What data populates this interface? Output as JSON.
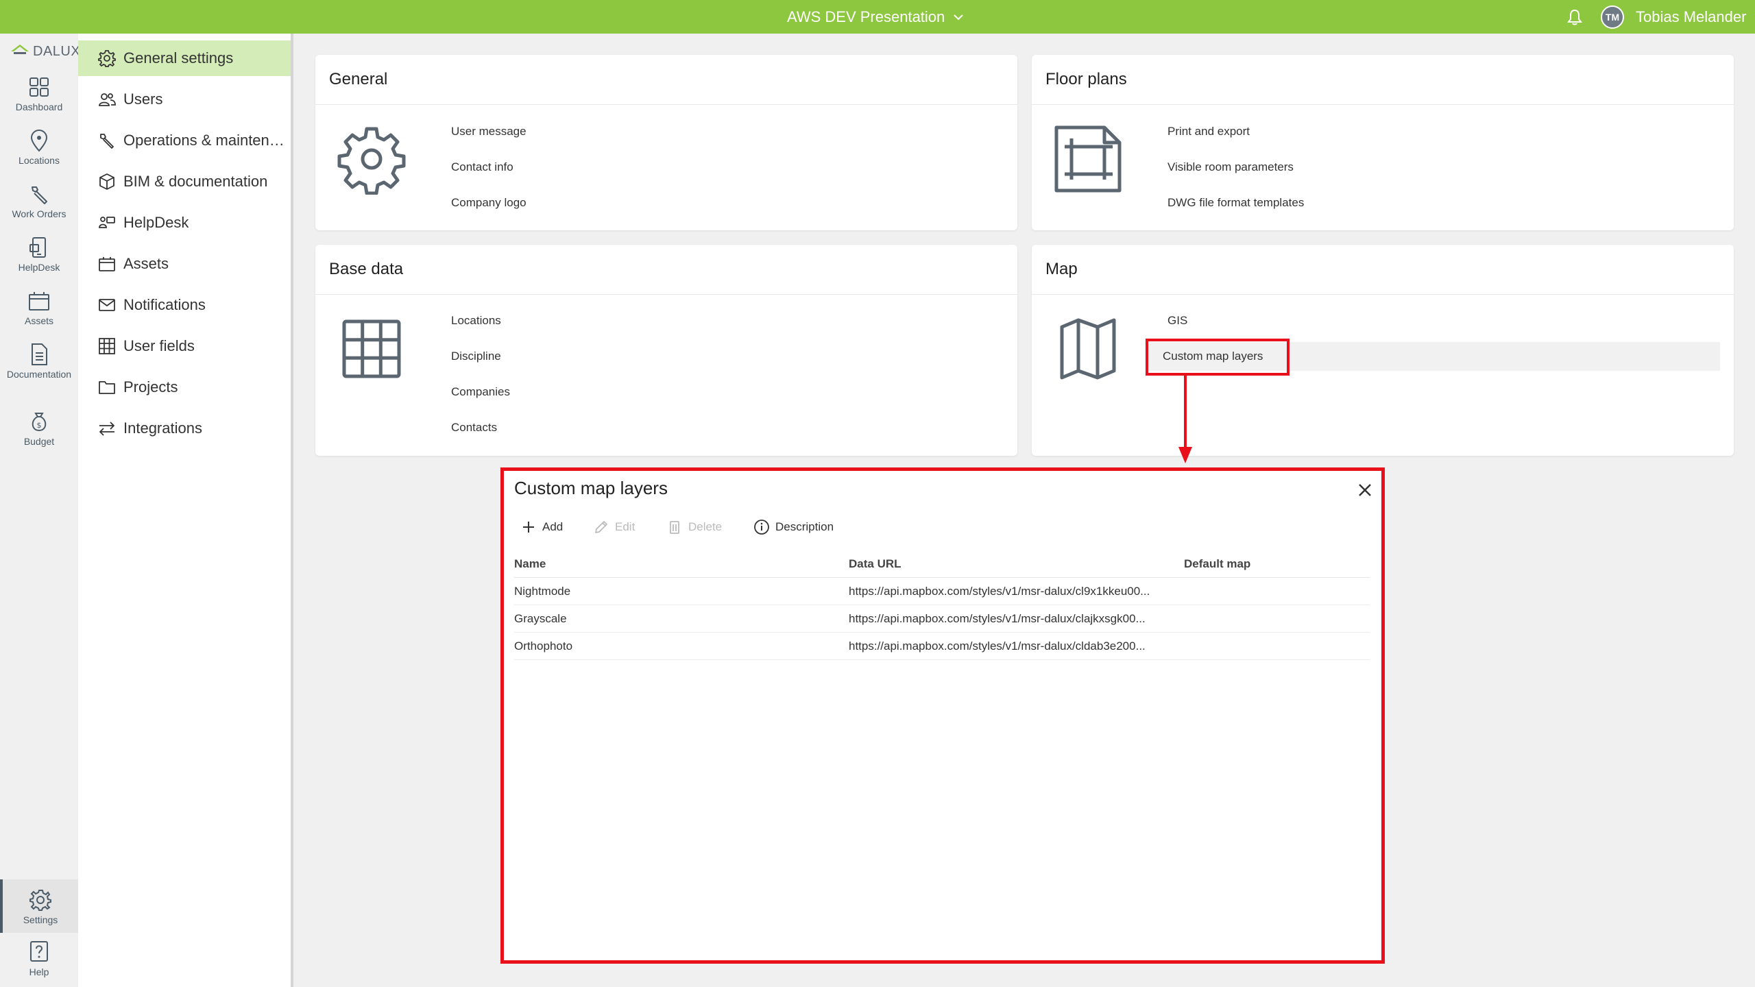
{
  "topbar": {
    "project": "AWS DEV Presentation",
    "user_initials": "TM",
    "user_name": "Tobias Melander"
  },
  "brand": {
    "name": "DALUX"
  },
  "rail": {
    "items": [
      {
        "label": "Dashboard",
        "icon": "grid-icon"
      },
      {
        "label": "Locations",
        "icon": "location-pin-icon"
      },
      {
        "label": "Work Orders",
        "icon": "wrench-icon"
      },
      {
        "label": "HelpDesk",
        "icon": "helpdesk-phone-icon"
      },
      {
        "label": "Assets",
        "icon": "asset-box-icon"
      },
      {
        "label": "Documentation",
        "icon": "document-icon"
      },
      {
        "label": "Budget",
        "icon": "money-bag-icon"
      }
    ],
    "settings": {
      "label": "Settings",
      "icon": "gear-icon"
    },
    "help": {
      "label": "Help",
      "icon": "question-icon"
    }
  },
  "menu": {
    "items": [
      {
        "label": "General settings",
        "icon": "gear-icon"
      },
      {
        "label": "Users",
        "icon": "users-icon"
      },
      {
        "label": "Operations & maintenance",
        "icon": "wrench-icon"
      },
      {
        "label": "BIM & documentation",
        "icon": "cube-icon"
      },
      {
        "label": "HelpDesk",
        "icon": "helpdesk-icon"
      },
      {
        "label": "Assets",
        "icon": "asset-box-icon"
      },
      {
        "label": "Notifications",
        "icon": "envelope-icon"
      },
      {
        "label": "User fields",
        "icon": "table-icon"
      },
      {
        "label": "Projects",
        "icon": "folder-icon"
      },
      {
        "label": "Integrations",
        "icon": "arrows-exchange-icon"
      }
    ]
  },
  "cards": {
    "general": {
      "title": "General",
      "links": [
        "User message",
        "Contact info",
        "Company logo"
      ]
    },
    "floor_plans": {
      "title": "Floor plans",
      "links": [
        "Print and export",
        "Visible room parameters",
        "DWG file format templates"
      ]
    },
    "base_data": {
      "title": "Base data",
      "links": [
        "Locations",
        "Discipline",
        "Companies",
        "Contacts"
      ]
    },
    "map": {
      "title": "Map",
      "links": [
        "GIS",
        "Custom map layers"
      ]
    }
  },
  "dialog": {
    "title": "Custom map layers",
    "toolbar": {
      "add": "Add",
      "edit": "Edit",
      "delete": "Delete",
      "description": "Description"
    },
    "columns": {
      "name": "Name",
      "data_url": "Data URL",
      "default_map": "Default map"
    },
    "rows": [
      {
        "name": "Nightmode",
        "data_url": "https://api.mapbox.com/styles/v1/msr-dalux/cl9x1kkeu00...",
        "default_map": ""
      },
      {
        "name": "Grayscale",
        "data_url": "https://api.mapbox.com/styles/v1/msr-dalux/clajkxsgk00...",
        "default_map": ""
      },
      {
        "name": "Orthophoto",
        "data_url": "https://api.mapbox.com/styles/v1/msr-dalux/cldab3e200...",
        "default_map": ""
      }
    ]
  },
  "colors": {
    "topbar": "#8dc63f",
    "active_menu": "#d4ecb7",
    "annotation_red": "#e8101a"
  }
}
